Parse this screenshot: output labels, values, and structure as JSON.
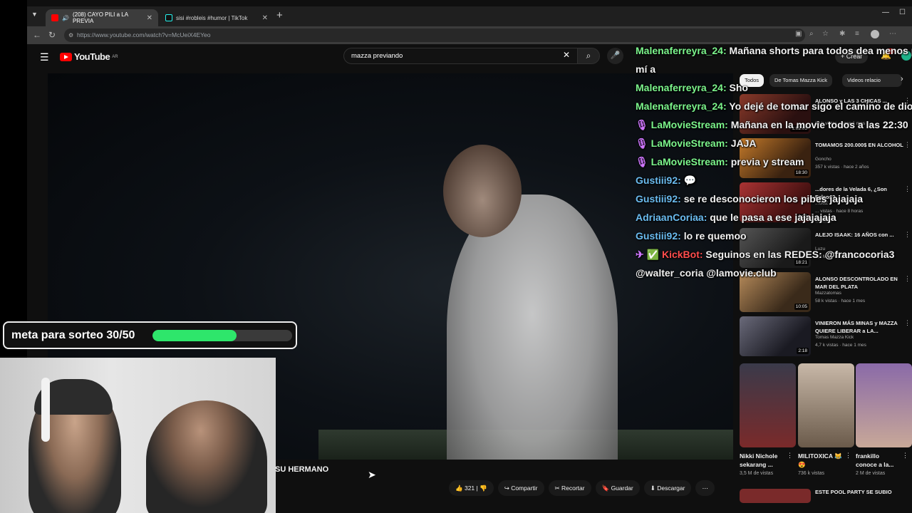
{
  "browser": {
    "tabs": [
      {
        "label": "(208) CAYO PILI a LA PREVIA",
        "active": true
      },
      {
        "label": "sisi #robleis #humor | TikTok",
        "active": false
      }
    ],
    "url": "https://www.youtube.com/watch?v=McUeiX4EYeo"
  },
  "youtube": {
    "logo_text": "YouTube",
    "region": "AR",
    "search_value": "mazza previando",
    "create_label": "Crear",
    "notif_count": "9+"
  },
  "chat": [
    {
      "user": "Malenaferreyra_24:",
      "msg": "Mañana shorts para todos dea menos pa",
      "icon": "",
      "cls": "u1"
    },
    {
      "user": "",
      "msg": "mí a",
      "icon": "",
      "cls": "u1"
    },
    {
      "user": "Malenaferreyra_24:",
      "msg": "Sho",
      "icon": "",
      "cls": "u1"
    },
    {
      "user": "Malenaferreyra_24:",
      "msg": "Yo dejé de tomar sigo el camino de dios",
      "icon": "",
      "cls": "u1"
    },
    {
      "user": "LaMovieStream:",
      "msg": "Mañana en la movie todos a las 22:30",
      "icon": "🎙",
      "cls": "u2"
    },
    {
      "user": "LaMovieStream:",
      "msg": "JAJA",
      "icon": "🎙",
      "cls": "u2"
    },
    {
      "user": "LaMovieStream:",
      "msg": "previa y stream",
      "icon": "🎙",
      "cls": "u2"
    },
    {
      "user": "Gustiii92:",
      "msg": "💬",
      "icon": "",
      "cls": "u3"
    },
    {
      "user": "Gustiii92:",
      "msg": "se re desconocieron los pibes jajajaja",
      "icon": "",
      "cls": "u3"
    },
    {
      "user": "AdriaanCoriaa:",
      "msg": "que le pasa a ese jajajajaja",
      "icon": "",
      "cls": "u3"
    },
    {
      "user": "Gustiii92:",
      "msg": "lo re quemoo",
      "icon": "",
      "cls": "u3"
    },
    {
      "user": "KickBot:",
      "msg": "Seguinos en las REDES: @francocoria3",
      "icon": "✈ ✅",
      "cls": "u4"
    },
    {
      "user": "",
      "msg": "@walter_coria @lamovie.club",
      "icon": "",
      "cls": "u4"
    }
  ],
  "sidebar": {
    "chips": [
      "Todos",
      "De Tomas Mazza Kick",
      "Videos relacio"
    ],
    "recs": [
      {
        "title": "ALONSO y LAS 3 CHICAS ...",
        "channel": "",
        "meta": "38 k vistas · hace 1 mes",
        "duration": "1:02:05",
        "nuevo": ""
      },
      {
        "title": "TOMAMOS 200.000$ EN ALCOHOL",
        "channel": "Goncho",
        "meta": "357 k vistas · hace 2 años",
        "duration": "18:30",
        "nuevo": ""
      },
      {
        "title": "...dores de la Velada 6, ¿Son Falsos?",
        "channel": "...cIoZ",
        "meta": "... vistas · hace 8 horas",
        "duration": "9:22",
        "nuevo": "Nuevo"
      },
      {
        "title": "ALEJO ISAAK: 16 AÑOS con ...",
        "channel": "Luzu",
        "meta": "3,2 M de vistas · hace 3 años",
        "duration": "18:21",
        "nuevo": ""
      },
      {
        "title": "ALONSO DESCONTROLADO EN MAR DEL PLATA",
        "channel": "Mazzatomas",
        "meta": "58 k vistas · hace 1 mes",
        "duration": "10:05",
        "nuevo": ""
      },
      {
        "title": "VINIERON MÁS MINAS y MAZZA QUIERE LIBERAR a LA...",
        "channel": "Tomas Mazza Kick",
        "meta": "4,7 k vistas · hace 1 mes",
        "duration": "2:18",
        "nuevo": ""
      }
    ],
    "shorts": [
      {
        "title": "Nikki Nichole sekarang ...",
        "views": "3,5 M de vistas"
      },
      {
        "title": "MILITOXICA 😹😍",
        "views": "736 k vistas"
      },
      {
        "title": "frankillo conoce a la...",
        "views": "2 M de vistas"
      }
    ],
    "last_rec_title": "ESTE POOL PARTY SE SUBIO"
  },
  "player": {
    "title_fragment": "SU HERMANO",
    "likes": "321",
    "share_label": "Compartir",
    "clip_label": "Recortar",
    "save_label": "Guardar",
    "download_label": "Descargar"
  },
  "goal": {
    "label": "meta para sorteo 30/50",
    "progress": 0.6,
    "fill_color": "#2ee66b"
  }
}
